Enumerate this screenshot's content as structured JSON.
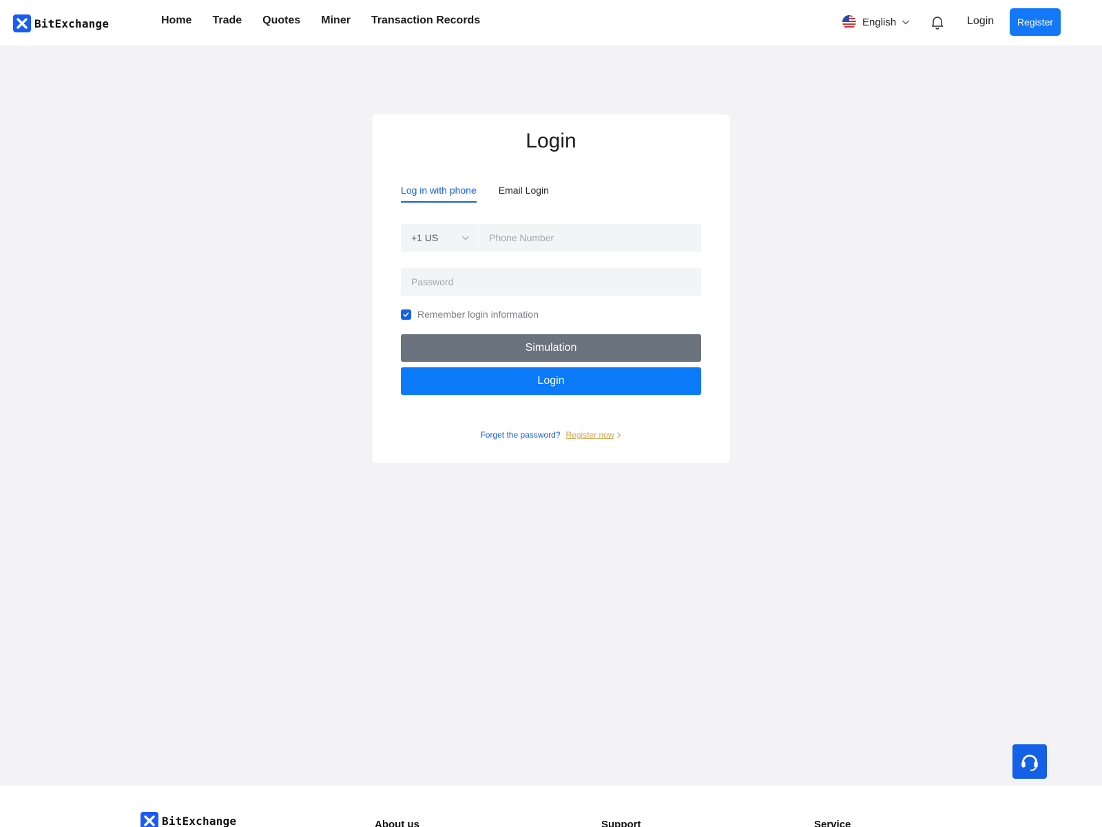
{
  "header": {
    "brand": "BitExchange",
    "nav": [
      {
        "label": "Home"
      },
      {
        "label": "Trade"
      },
      {
        "label": "Quotes"
      },
      {
        "label": "Miner"
      },
      {
        "label": "Transaction Records"
      }
    ],
    "language": "English",
    "login_label": "Login",
    "register_label": "Register"
  },
  "login_card": {
    "title": "Login",
    "tabs": [
      {
        "label": "Log in with phone",
        "active": true
      },
      {
        "label": "Email Login",
        "active": false
      }
    ],
    "country_code": "+1 US",
    "phone_placeholder": "Phone Number",
    "password_placeholder": "Password",
    "remember_label": "Remember login information",
    "remember_checked": true,
    "simulation_label": "Simulation",
    "login_button_label": "Login",
    "forgot_label": "Forget the password?",
    "register_now_label": "Register now"
  },
  "footer": {
    "brand": "BitExchange",
    "columns": [
      {
        "title": "About us"
      },
      {
        "title": "Support"
      },
      {
        "title": "Service"
      }
    ]
  },
  "colors": {
    "accent": "#1460e6",
    "primary_button": "#0a7af8",
    "simulation_button": "#6b737e",
    "link_gold": "#d4a44f",
    "page_bg": "#f3f3f6"
  },
  "icons": [
    "x-logo-icon",
    "us-flag-icon",
    "chevron-down-icon",
    "bell-icon",
    "chevron-right-icon",
    "checkmark-icon",
    "headset-icon"
  ]
}
